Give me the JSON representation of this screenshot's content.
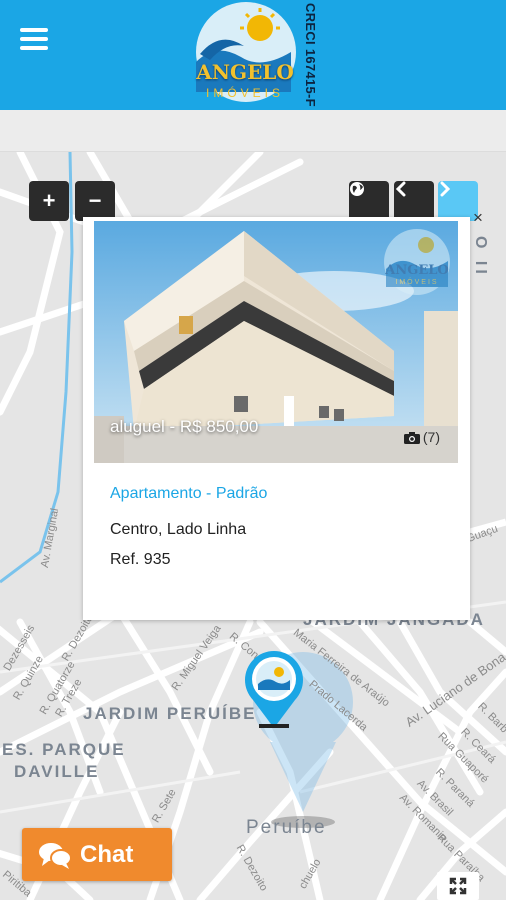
{
  "header": {
    "menu_icon": "hamburger-icon",
    "logo": {
      "brand": "ANGELO",
      "tagline": "IMÓVEIS"
    },
    "creci": "CRECI 167415-F"
  },
  "map": {
    "controls": {
      "zoom_in": "+",
      "zoom_out": "−",
      "globe_icon": "globe-icon",
      "prev_icon": "chevron-left-icon",
      "next_icon": "chevron-right-icon",
      "fullscreen_icon": "fullscreen-icon"
    },
    "area_labels": [
      "JARDIM JANGADA",
      "JARDIM PERUÍBE",
      "ES. PARQUE",
      "DAVILLE",
      "Peruíbe"
    ],
    "street_labels": {
      "marginal": "Av. Marginal",
      "quinze": "R. Quinze",
      "quatorze": "R. Quatorze",
      "treze": "R. Treze",
      "dezesseis": "Dezesseis",
      "dezoito": "R. Dezoito",
      "miguel_veiga": "R. Miguel Veiga",
      "conn": "R. Conn",
      "maria_ferreira": "Maria Ferreira de Araújo",
      "prado_lacerda": "Prado Lacerda",
      "luciano": "Av. Luciano de Bona",
      "guapore": "Rua Guaporé",
      "ceara": "R. Ceará",
      "parana": "R. Paraná",
      "brasil": "Av. Brasil",
      "romania": "Av. Romania",
      "paraiba": "Rua Paraíba",
      "barbosa": "R. Barb",
      "sete": "R. Sete",
      "dezoito2": "R. Dezoito",
      "chuelo": "chuelo",
      "piritiba": "Piritiba",
      "guacu": "Guaçu"
    }
  },
  "card": {
    "close_label": "×",
    "price": "aluguel - R$ 850,00",
    "photo_count": "(7)",
    "camera_icon": "camera-icon",
    "type": "Apartamento - Padrão",
    "location": "Centro, Lado Linha",
    "ref": "Ref. 935",
    "watermark": {
      "brand": "ANGELO",
      "tagline": "IMÓVEIS"
    },
    "side_letters": "O II"
  },
  "chat": {
    "label": "Chat",
    "icon": "chat-bubbles-icon"
  }
}
